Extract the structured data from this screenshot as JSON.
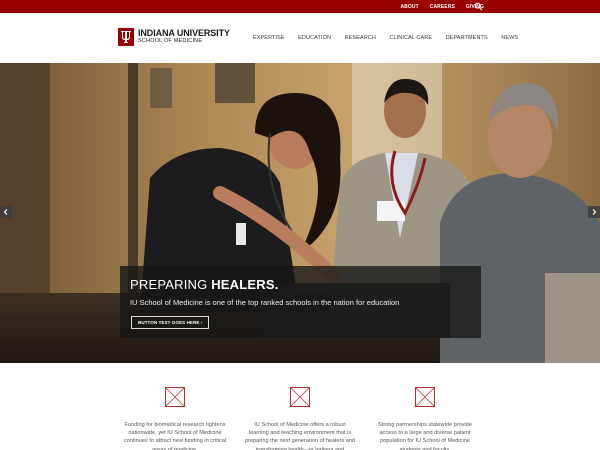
{
  "utility_bar": {
    "links": [
      "ABOUT",
      "CAREERS",
      "GIVING"
    ],
    "search_icon": "search-icon"
  },
  "header": {
    "logo_name": "INDIANA UNIVERSITY",
    "logo_subname": "SCHOOL OF MEDICINE",
    "nav": [
      "EXPERTISE",
      "EDUCATION",
      "RESEARCH",
      "CLINICAL CARE",
      "DEPARTMENTS",
      "NEWS"
    ]
  },
  "hero": {
    "title_light": "PREPARING ",
    "title_bold": "HEALERS.",
    "description": "IU School of Medicine is one of the top ranked schools in the nation for education",
    "button_label": "BUTTON TEXT GOES HERE ›",
    "prev_icon": "chevron-left-icon",
    "next_icon": "chevron-right-icon"
  },
  "features": [
    {
      "icon": "image-placeholder-icon",
      "text": "Funding for biomedical research tightens nationwide, yet IU School of Medicine continues to attract new funding in critical areas of medicine."
    },
    {
      "icon": "image-placeholder-icon",
      "text": "IU School of Medicine offers a robust learning and teaching environment that is preparing the next generation of healers and transforming health—in Indiana and"
    },
    {
      "icon": "image-placeholder-icon",
      "text": "Strong partnerships statewide provide access to a large and diverse patient population for IU School of Medicine students and faculty."
    }
  ],
  "colors": {
    "brand_crimson": "#990000",
    "caption_bg": "rgba(22,22,22,0.78)"
  }
}
